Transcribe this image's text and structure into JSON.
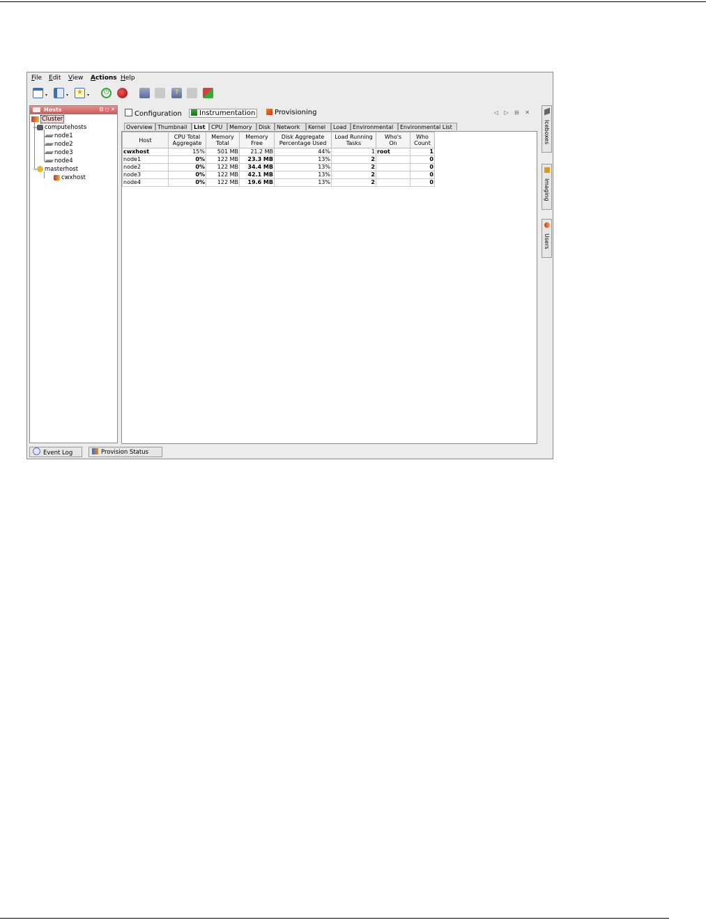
{
  "menu": {
    "items": [
      {
        "mnemonic": "F",
        "rest": "ile"
      },
      {
        "mnemonic": "E",
        "rest": "dit"
      },
      {
        "mnemonic": "V",
        "rest": "iew"
      },
      {
        "mnemonic": "A",
        "rest": "ctions"
      },
      {
        "mnemonic": "H",
        "rest": "elp"
      }
    ]
  },
  "toolbar": {
    "icons": [
      "new-window-icon",
      "layout-icon",
      "favorites-icon",
      "power-on-icon",
      "power-off-icon",
      "host-add-icon",
      "host-blank-icon",
      "host-info-icon",
      "host-blank-icon-2",
      "provision-icon"
    ]
  },
  "hosts_panel": {
    "title": "Hosts",
    "controls": "⊟ ◻ ✕",
    "tree": {
      "root": "Cluster",
      "group1": "computehosts",
      "nodes": [
        "node1",
        "node2",
        "node3",
        "node4"
      ],
      "group2": "masterhost",
      "master_child": "cwxhost"
    }
  },
  "main": {
    "top_tabs": [
      "Configuration",
      "Instrumentation",
      "Provisioning"
    ],
    "active_top_tab": "Instrumentation",
    "nav_controls": "◁ ▷ ⊟ ✕",
    "sub_tabs": [
      "Overview",
      "Thumbnail",
      "List",
      "CPU",
      "Memory",
      "Disk",
      "Network",
      "Kernel",
      "Load",
      "Environmental",
      "Environmental List"
    ],
    "active_sub_tab": "List"
  },
  "table": {
    "headers": [
      [
        "Host",
        ""
      ],
      [
        "CPU Total",
        "Aggregate"
      ],
      [
        "Memory",
        "Total"
      ],
      [
        "Memory",
        "Free"
      ],
      [
        "Disk Aggregate",
        "Percentage Used"
      ],
      [
        "Load Running",
        "Tasks"
      ],
      [
        "Who's",
        "On"
      ],
      [
        "Who",
        "Count"
      ]
    ],
    "rows": [
      [
        "cwxhost",
        "15%",
        "501 MB",
        "21.2 MB",
        "44%",
        "1",
        "root",
        "1"
      ],
      [
        "node1",
        "0%",
        "122 MB",
        "23.3 MB",
        "13%",
        "2",
        "",
        "0"
      ],
      [
        "node2",
        "0%",
        "122 MB",
        "34.4 MB",
        "13%",
        "2",
        "",
        "0"
      ],
      [
        "node3",
        "0%",
        "122 MB",
        "42.1 MB",
        "13%",
        "2",
        "",
        "0"
      ],
      [
        "node4",
        "0%",
        "122 MB",
        "19.6 MB",
        "13%",
        "2",
        "",
        "0"
      ]
    ]
  },
  "side_tabs": [
    "Iceboxes",
    "Imaging",
    "Users"
  ],
  "bottom_tabs": [
    "Event Log",
    "Provision Status"
  ]
}
